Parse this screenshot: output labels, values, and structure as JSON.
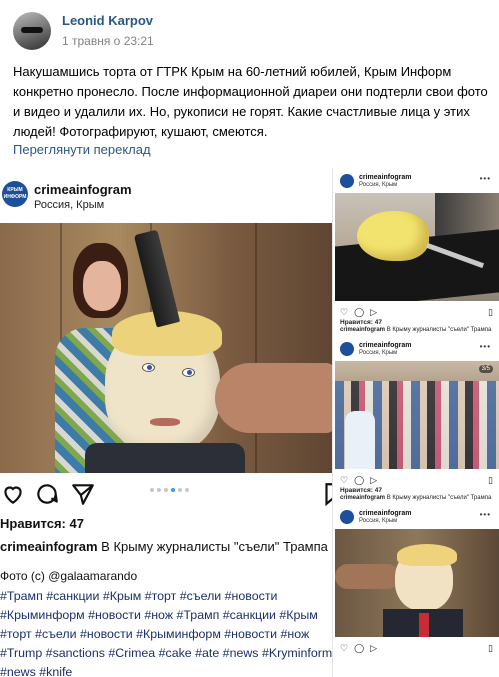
{
  "post": {
    "author": "Leonid Karpov",
    "date": "1 травня о 23:21",
    "text": "Накушамшись торта от ГТРК Крым на 60-летний юбилей, Крым Информ конкретно пронесло. После информационной диареи они подтерли свои фото и видео и удалили их. Но, рукописи не горят. Какие счастливые лица у этих людей! Фотографируют, кушают, смеются.",
    "translate_link": "Переглянути переклад"
  },
  "main_card": {
    "logo_text": "КРЫМ ИНФОРМ",
    "account": "crimeainfogram",
    "location": "Россия, Крым",
    "likes": "Нравится: 47",
    "caption_user": "crimeainfogram",
    "caption_text": "В Крыму журналисты \"съели\" Трампа",
    "credit": "Фото (с) @galaamarando",
    "hashtags": "#Трамп #санкции #Крым #торт #съели #новости #Крыминформ #новости #нож #Трамп #санкции #Крым #торт #съели #новости #Крыминформ #новости #нож #Trump #sanctions #Crimea #cake #ate #news #Kryminform #news #knife",
    "carousel": {
      "count": 6,
      "active": 4
    }
  },
  "side_cards": [
    {
      "account": "crimeainfogram",
      "location": "Россия, Крым",
      "more": "•••",
      "likes": "Нравится: 47",
      "caption_user": "crimeainfogram",
      "caption_text": "В Крыму журналисты \"съели\" Трампа"
    },
    {
      "account": "crimeainfogram",
      "location": "Россия, Крым",
      "more": "•••",
      "counter": "3/5",
      "likes": "Нравится: 47",
      "caption_user": "crimeainfogram",
      "caption_text": "В Крыму журналисты \"съели\" Трампа"
    },
    {
      "account": "crimeainfogram",
      "location": "Россия, Крым",
      "more": "•••"
    }
  ],
  "colors": {
    "link": "#2a5885",
    "muted": "#828282",
    "hashtag": "#1c2f6b",
    "carousel_active": "#3897f0"
  },
  "icons": [
    "heart-icon",
    "comment-icon",
    "share-icon",
    "bookmark-icon"
  ]
}
